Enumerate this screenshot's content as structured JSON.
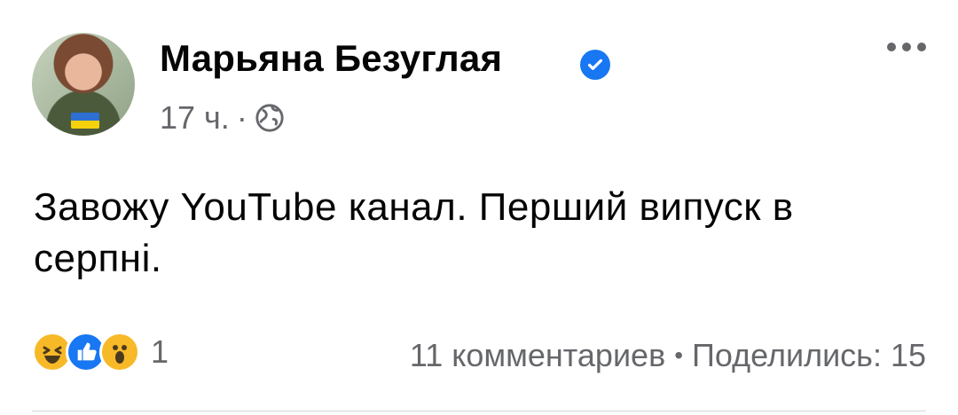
{
  "author": {
    "name": "Марьяна Безуглая"
  },
  "post": {
    "time": "17 ч.",
    "dot": "·",
    "text": "Завожу YouTube канал. Перший випуск в серпні."
  },
  "reactions": {
    "count": "1"
  },
  "stats": {
    "comments": "11 комментариев",
    "separator": "•",
    "shares": "Поделились: 15"
  },
  "icons": [
    "verified-badge-icon",
    "globe-icon",
    "more-options-icon",
    "haha-reaction-icon",
    "like-reaction-icon",
    "wow-reaction-icon"
  ],
  "colors": {
    "accent": "#1877f2",
    "secondary_text": "#65676b"
  }
}
